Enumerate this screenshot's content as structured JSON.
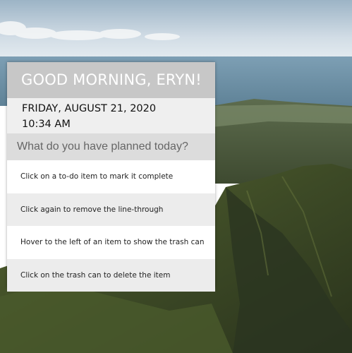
{
  "greeting": "GOOD MORNING, ERYN!",
  "date": "FRIDAY, AUGUST 21, 2020",
  "time": "10:34 AM",
  "todo_input": {
    "placeholder": "What do you have planned today?",
    "value": ""
  },
  "todos": [
    {
      "text": "Click on a to-do item to mark it complete"
    },
    {
      "text": "Click again to remove the line-through"
    },
    {
      "text": "Hover to the left of an item to show the trash can"
    },
    {
      "text": "Click on the trash can to delete the item"
    }
  ],
  "colors": {
    "header_bg": "#c7c7c7",
    "date_bg": "#efefef",
    "input_bg": "#dcdcdc",
    "row_alt_bg": "#ececec"
  }
}
